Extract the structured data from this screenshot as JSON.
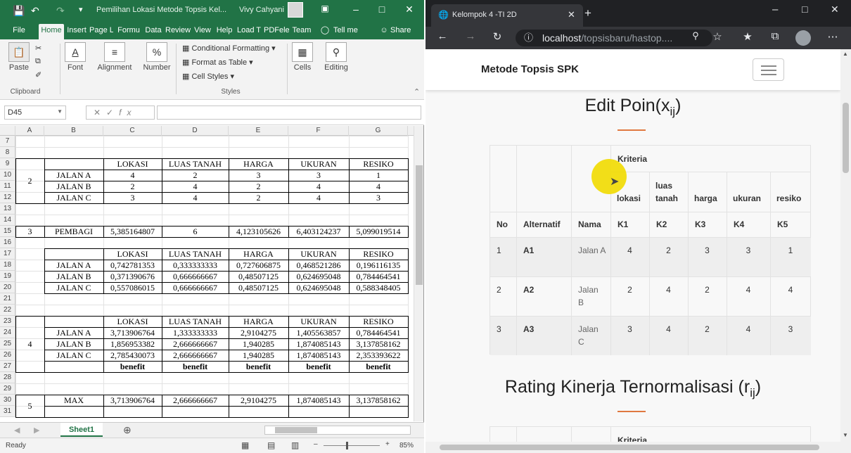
{
  "excel": {
    "title": "Pemilihan Lokasi Metode Topsis Kel...",
    "user": "Vivy Cahyani",
    "tabs": [
      "File",
      "Home",
      "Insert",
      "Page L",
      "Formu",
      "Data",
      "Review",
      "View",
      "Help",
      "Load T",
      "PDFele",
      "Team"
    ],
    "tell_me": "Tell me",
    "share": "Share",
    "ribbon": {
      "paste": "Paste",
      "clipboard": "Clipboard",
      "font": "Font",
      "alignment": "Alignment",
      "number": "Number",
      "conditional_formatting": "Conditional Formatting",
      "format_as_table": "Format as Table",
      "cell_styles": "Cell Styles",
      "styles": "Styles",
      "cells": "Cells",
      "editing": "Editing"
    },
    "name_box": "D45",
    "columns": [
      "A",
      "B",
      "C",
      "D",
      "E",
      "F",
      "G"
    ],
    "rows": [
      "7",
      "8",
      "9",
      "10",
      "11",
      "12",
      "13",
      "14",
      "15",
      "16",
      "17",
      "18",
      "19",
      "20",
      "21",
      "22",
      "23",
      "24",
      "25",
      "26",
      "27",
      "28",
      "29",
      "30",
      "31"
    ],
    "cells": {
      "r9": [
        "",
        "",
        "LOKASI",
        "LUAS TANAH",
        "HARGA",
        "UKURAN",
        "RESIKO"
      ],
      "r10": [
        "2",
        "JALAN A",
        "4",
        "2",
        "3",
        "3",
        "1"
      ],
      "r11": [
        "",
        "JALAN B",
        "2",
        "4",
        "2",
        "4",
        "4"
      ],
      "r12": [
        "",
        "JALAN C",
        "3",
        "4",
        "2",
        "4",
        "3"
      ],
      "r15": [
        "3",
        "PEMBAGI",
        "5,385164807",
        "6",
        "4,123105626",
        "6,403124237",
        "5,099019514"
      ],
      "r17": [
        "",
        "",
        "LOKASI",
        "LUAS TANAH",
        "HARGA",
        "UKURAN",
        "RESIKO"
      ],
      "r18": [
        "",
        "JALAN A",
        "0,742781353",
        "0,333333333",
        "0,727606875",
        "0,468521286",
        "0,196116135"
      ],
      "r19": [
        "",
        "JALAN B",
        "0,371390676",
        "0,666666667",
        "0,48507125",
        "0,624695048",
        "0,784464541"
      ],
      "r20": [
        "",
        "JALAN C",
        "0,557086015",
        "0,666666667",
        "0,48507125",
        "0,624695048",
        "0,588348405"
      ],
      "r23": [
        "4",
        "",
        "LOKASI",
        "LUAS TANAH",
        "HARGA",
        "UKURAN",
        "RESIKO"
      ],
      "r24": [
        "",
        "JALAN A",
        "3,713906764",
        "1,333333333",
        "2,9104275",
        "1,405563857",
        "0,784464541"
      ],
      "r25": [
        "",
        "JALAN B",
        "1,856953382",
        "2,666666667",
        "1,940285",
        "1,874085143",
        "3,137858162"
      ],
      "r26": [
        "",
        "JALAN C",
        "2,785430073",
        "2,666666667",
        "1,940285",
        "1,874085143",
        "2,353393622"
      ],
      "r27": [
        "",
        "",
        "benefit",
        "benefit",
        "benefit",
        "benefit",
        "benefit"
      ],
      "r30": [
        "5",
        "MAX",
        "3,713906764",
        "2,666666667",
        "2,9104275",
        "1,874085143",
        "3,137858162"
      ]
    },
    "sheet_tab": "Sheet1",
    "status": "Ready",
    "zoom": "85%"
  },
  "browser": {
    "tab_title": "Kelompok 4 -TI 2D",
    "url_host": "localhost",
    "url_path": "/topsisbaru/hastop....",
    "brand": "Metode Topsis SPK",
    "section1": {
      "title": "Edit Poin(x",
      "sub": "ij",
      "close": ")"
    },
    "section2": {
      "title": "Rating Kinerja Ternormalisasi (r",
      "sub": "ij",
      "close": ")"
    },
    "table": {
      "kriteria": "Kriteria",
      "crit_names": [
        "lokasi",
        "luas tanah",
        "harga",
        "ukuran",
        "resiko"
      ],
      "headers": [
        "No",
        "Alternatif",
        "Nama",
        "K1",
        "K2",
        "K3",
        "K4",
        "K5"
      ],
      "rows": [
        {
          "no": "1",
          "alt": "A1",
          "nama": "Jalan A",
          "vals": [
            "4",
            "2",
            "3",
            "3",
            "1"
          ]
        },
        {
          "no": "2",
          "alt": "A2",
          "nama": "Jalan B",
          "vals": [
            "2",
            "4",
            "2",
            "4",
            "4"
          ]
        },
        {
          "no": "3",
          "alt": "A3",
          "nama": "Jalan C",
          "vals": [
            "3",
            "4",
            "2",
            "4",
            "3"
          ]
        }
      ]
    },
    "table2_kriteria": "Kriteria"
  },
  "colors": {
    "excel_green": "#217346",
    "accent_orange": "#e07840",
    "highlight": "#f2dc00"
  }
}
